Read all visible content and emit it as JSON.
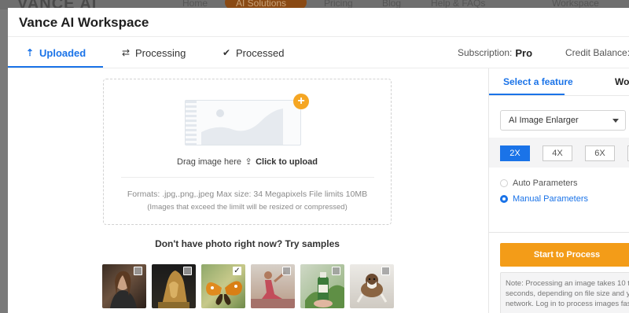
{
  "background_nav": {
    "logo": "VANCE AI",
    "links": [
      "Home",
      "AI Solutions",
      "Pricing",
      "Blog",
      "Help & FAQs",
      "Workspace"
    ]
  },
  "modal": {
    "title": "Vance AI Workspace"
  },
  "tabs": [
    {
      "icon": "upload-arrow-icon",
      "glyph": "⇡",
      "label": "Uploaded",
      "active": true
    },
    {
      "icon": "refresh-icon",
      "glyph": "⇄",
      "label": "Processing",
      "active": false
    },
    {
      "icon": "check-circle-icon",
      "glyph": "✔",
      "label": "Processed",
      "active": false
    }
  ],
  "account": {
    "subscription_label": "Subscription:",
    "subscription_value": "Pro",
    "credit_label": "Credit Balance:"
  },
  "upload": {
    "drag_text": "Drag image here",
    "click_text": "Click to upload",
    "formats": "Formats: .jpg,.png,.jpeg Max size: 34 Megapixels File limits 10MB",
    "resize_note": "(Images that exceed the limilt will be resized or compressed)"
  },
  "samples": {
    "title": "Don't have photo right now? Try samples",
    "items": [
      {
        "name": "woman-portrait",
        "checked": false
      },
      {
        "name": "golden-statue",
        "checked": false
      },
      {
        "name": "butterfly",
        "checked": true
      },
      {
        "name": "yoga-woman",
        "checked": false
      },
      {
        "name": "green-bottle",
        "checked": false
      },
      {
        "name": "dog-jumping",
        "checked": false
      }
    ]
  },
  "panel": {
    "tabs": [
      "Select a feature",
      "Wo"
    ],
    "feature_select": "AI Image Enlarger",
    "scales": [
      "2X",
      "4X",
      "6X"
    ],
    "active_scale": "2X",
    "radio_auto": "Auto Parameters",
    "radio_manual": "Manual Parameters",
    "start_button": "Start to Process",
    "note_lines": [
      "Note: Processing an image takes 10 t",
      "seconds, depending on file size and y",
      "network. Log in to process images fas"
    ]
  },
  "colors": {
    "accent": "#1a73e8",
    "orange": "#f39c18"
  }
}
